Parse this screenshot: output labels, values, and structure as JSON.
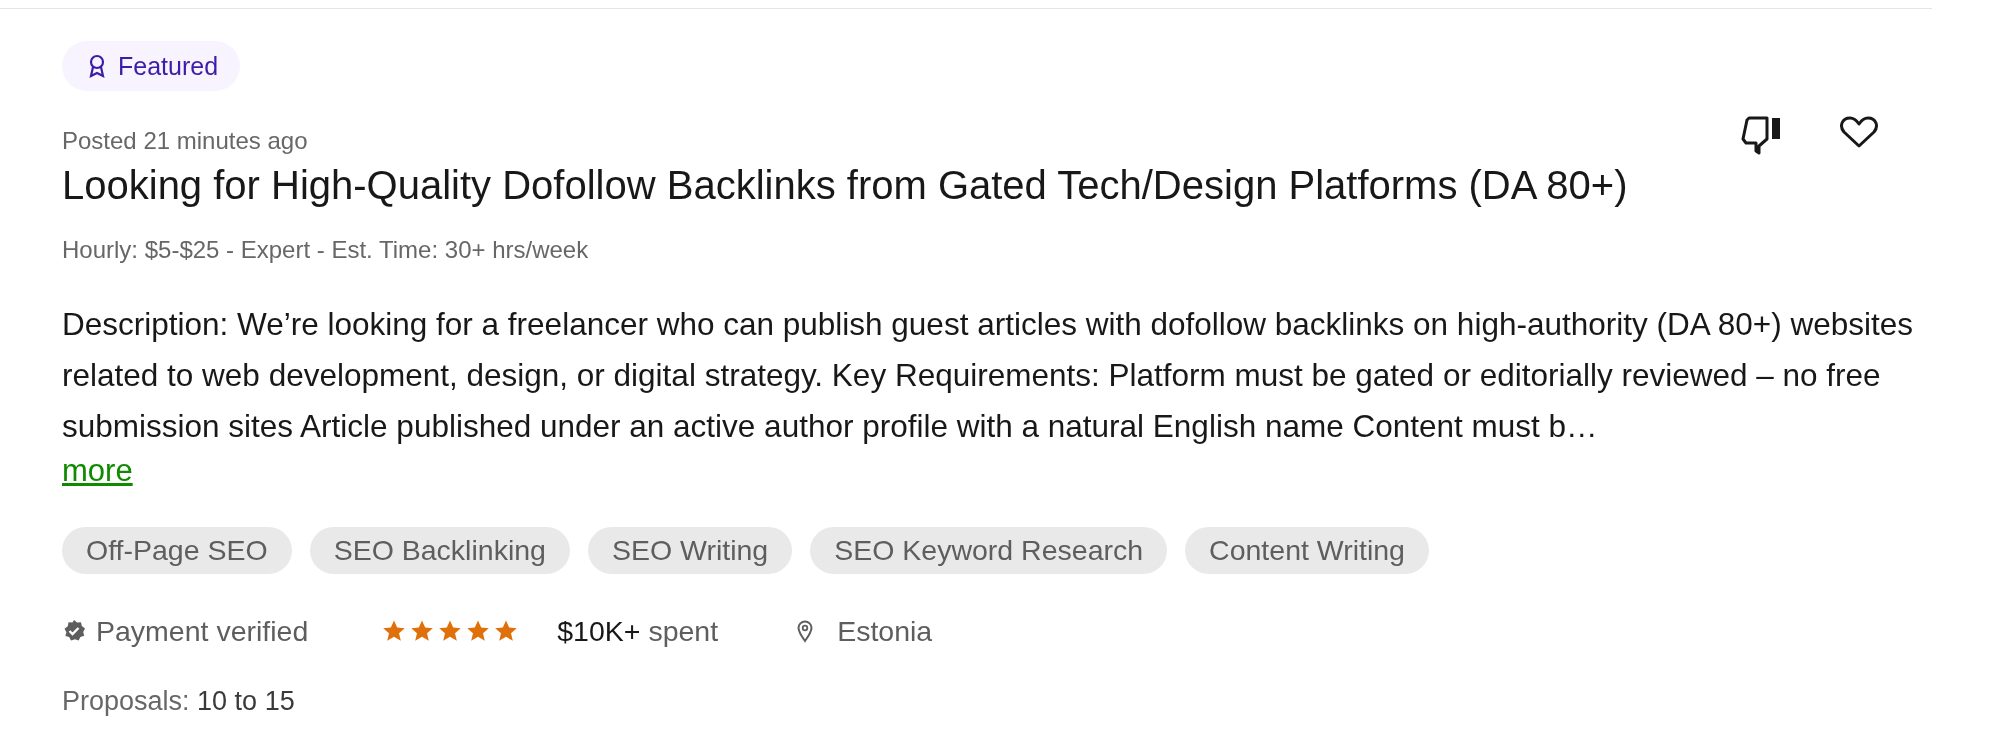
{
  "badge": {
    "label": "Featured"
  },
  "posted": "Posted 21 minutes ago",
  "title": "Looking for High-Quality Dofollow Backlinks from Gated Tech/Design Platforms (DA 80+)",
  "meta": "Hourly: $5-$25 - Expert - Est. Time: 30+ hrs/week",
  "description": "Description: We’re looking for a freelancer who can publish guest articles with dofollow backlinks on high-authority (DA 80+) websites related to web development, design, or digital strategy. Key Requirements: Platform must be gated or editorially reviewed – no free submission sites Article published under an active author profile with a natural English name Content must b…",
  "more_link": "more",
  "skills": [
    "Off-Page SEO",
    "SEO Backlinking",
    "SEO Writing",
    "SEO Keyword Research",
    "Content Writing"
  ],
  "client": {
    "payment_verified": true,
    "payment_label": "Payment verified",
    "stars": 5,
    "spent": "**$10K+** spent",
    "location": "Estonia"
  },
  "proposals": "Proposals: **10 to 15**"
}
